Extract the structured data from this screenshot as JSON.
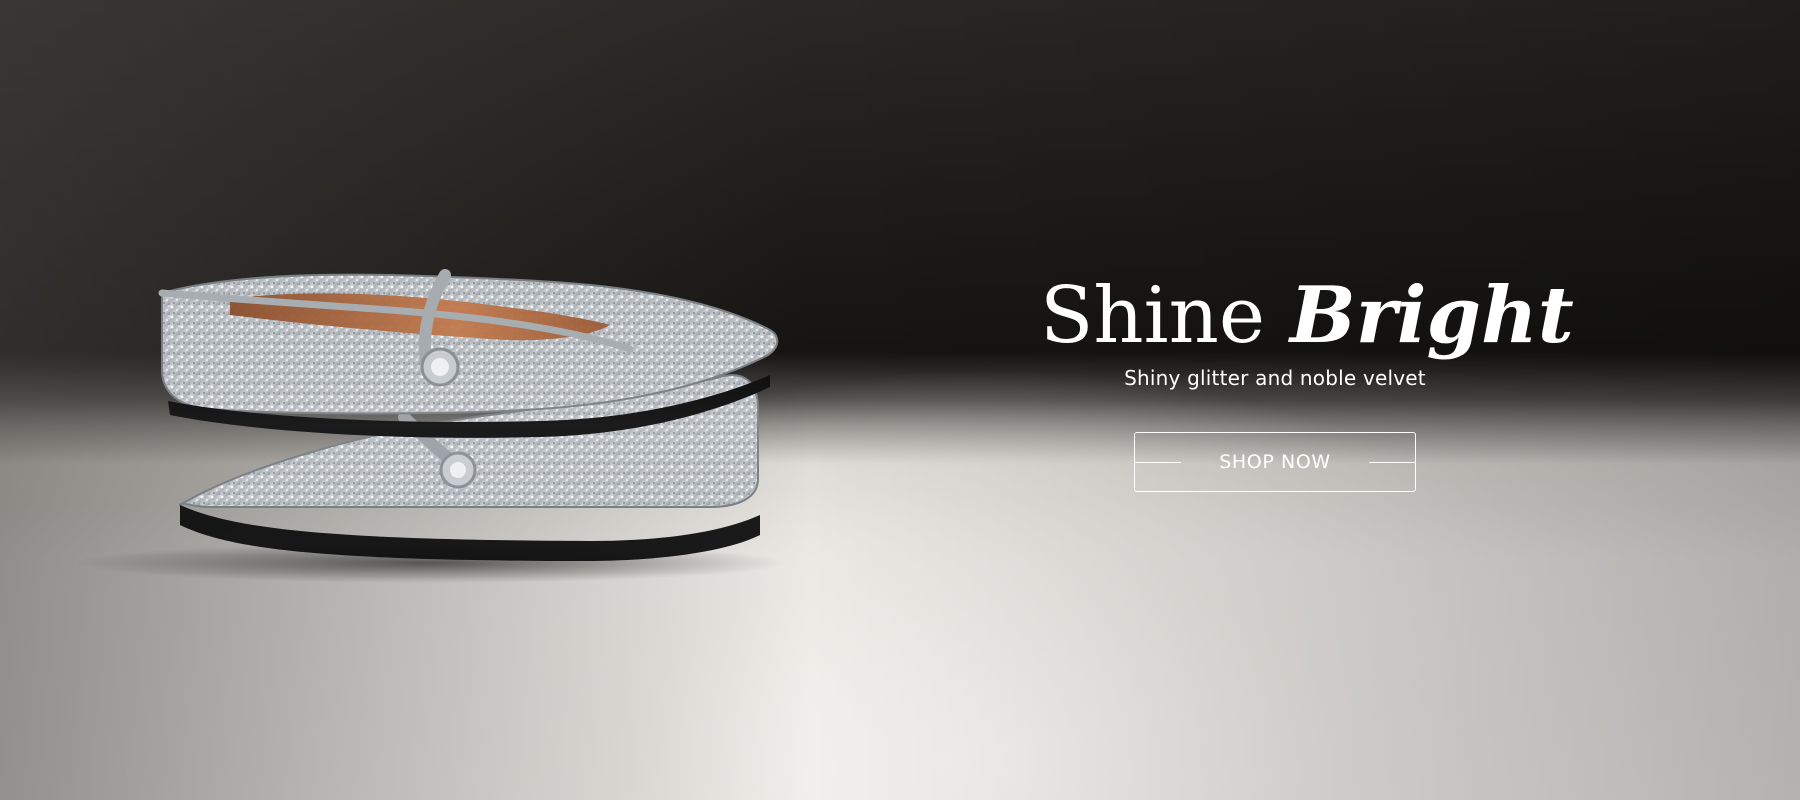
{
  "hero": {
    "headline_regular": "Shine",
    "headline_italic": "Bright",
    "subheadline": "Shiny glitter and noble velvet",
    "cta_label": "SHOP NOW",
    "product_image_alt": "silver glitter mary jane flats"
  },
  "colors": {
    "text": "#ffffff",
    "background_dark": "#141312",
    "background_light": "#efede9",
    "glitter": "#b9bdc2",
    "lining": "#b26c43"
  },
  "icons": {
    "cta_decor": "horizontal-line"
  }
}
